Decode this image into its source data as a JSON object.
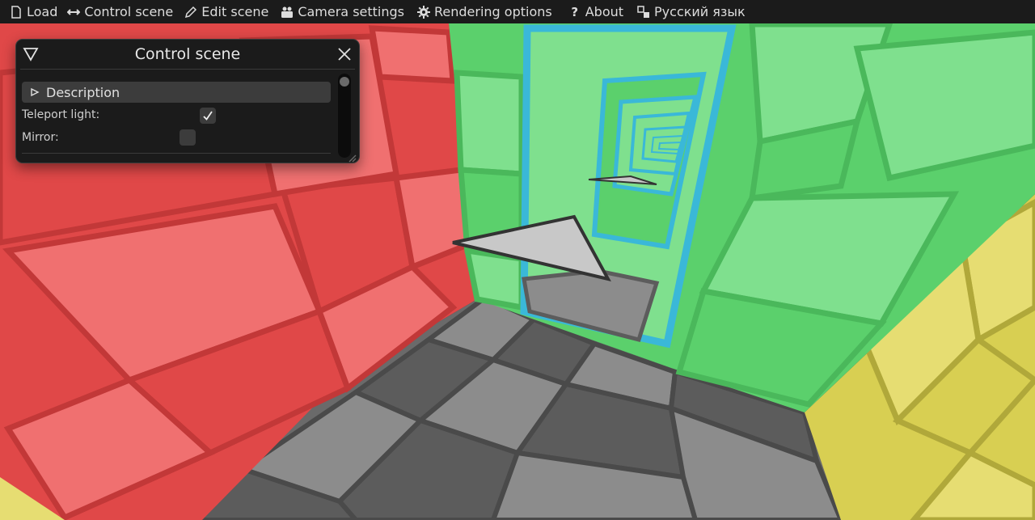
{
  "menu": {
    "items": [
      {
        "label": "Load",
        "icon": "file-icon"
      },
      {
        "label": "Control scene",
        "icon": "arrows-icon"
      },
      {
        "label": "Edit scene",
        "icon": "pencil-icon"
      },
      {
        "label": "Camera settings",
        "icon": "camera-icon"
      },
      {
        "label": "Rendering options",
        "icon": "gear-icon"
      },
      {
        "label": "About",
        "icon": "question-icon"
      },
      {
        "label": "Русский язык",
        "icon": "language-icon"
      }
    ]
  },
  "panel": {
    "title": "Control scene",
    "description_label": "Description",
    "teleport_label": "Teleport light:",
    "teleport_checked": true,
    "mirror_label": "Mirror:",
    "mirror_checked": false
  },
  "colors": {
    "red_wall": "#e04848",
    "green_wall": "#6fd97f",
    "yellow_wall": "#d8cf52",
    "floor_dark": "#5a5a5a",
    "floor_light": "#8c8c8c",
    "portal_frame": "#3ab8d8",
    "menu_bg": "#1b1b1b"
  }
}
